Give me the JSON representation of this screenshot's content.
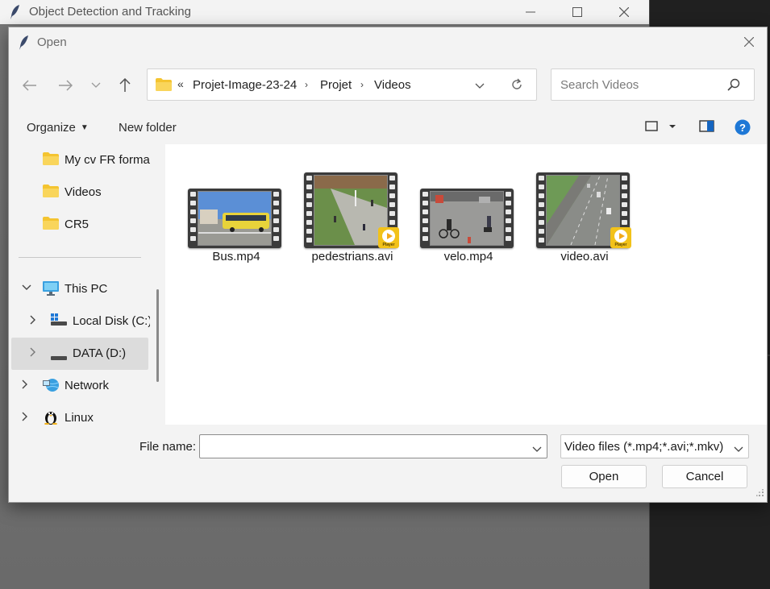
{
  "background_window": {
    "title": "Object Detection and Tracking"
  },
  "dialog": {
    "title": "Open",
    "address": {
      "crumbs": [
        "Projet-Image-23-24",
        "Projet",
        "Videos"
      ],
      "overflow": "«"
    },
    "search": {
      "placeholder": "Search Videos"
    },
    "commands": {
      "organize": "Organize",
      "new_folder": "New folder"
    },
    "nav_tree": [
      {
        "label": "My cv FR format",
        "icon": "folder-icon"
      },
      {
        "label": "Videos",
        "icon": "folder-icon"
      },
      {
        "label": "CR5",
        "icon": "folder-icon"
      },
      {
        "label": "This PC",
        "icon": "monitor-icon",
        "expanded": true
      },
      {
        "label": "Local Disk (C:)",
        "icon": "windows-drive-icon"
      },
      {
        "label": "DATA (D:)",
        "icon": "drive-icon",
        "selected": true
      },
      {
        "label": "Network",
        "icon": "network-icon"
      },
      {
        "label": "Linux",
        "icon": "linux-icon"
      }
    ],
    "files": [
      {
        "name": "Bus.mp4",
        "thumb_colors": [
          "#5b8fd6",
          "#e8d33a"
        ],
        "has_player_badge": false
      },
      {
        "name": "pedestrians.avi",
        "thumb_colors": [
          "#6b8f4a",
          "#b8b8b0"
        ],
        "has_player_badge": true
      },
      {
        "name": "velo.mp4",
        "thumb_colors": [
          "#9a9a98",
          "#c84a3a"
        ],
        "has_player_badge": false
      },
      {
        "name": "video.avi",
        "thumb_colors": [
          "#8a8c88",
          "#6e9a56"
        ],
        "has_player_badge": true
      }
    ],
    "badge_text": "Player",
    "file_name": {
      "label": "File name:",
      "value": ""
    },
    "filter": {
      "selected": "Video files (*.mp4;*.avi;*.mkv)"
    },
    "buttons": {
      "open": "Open",
      "cancel": "Cancel"
    }
  }
}
